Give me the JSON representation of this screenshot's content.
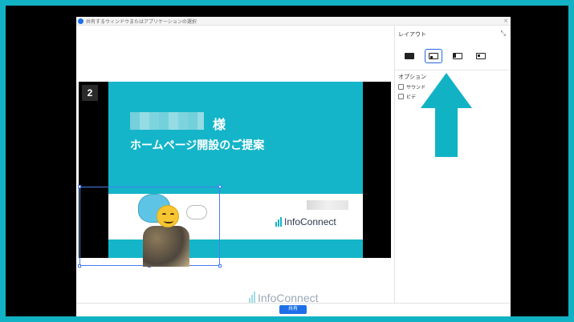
{
  "window": {
    "title": "共有するウィンドウまたはアプリケーションの選択",
    "close_glyph": "×"
  },
  "slide": {
    "page_number": "2",
    "honorific": "様",
    "title": "ホームページ開設のご提案",
    "logo_text": "InfoConnect"
  },
  "preview": {
    "logo_text": "InfoConnect"
  },
  "layout_panel": {
    "title": "レイアウト",
    "collapse_glyph": "⤡",
    "options_title": "オプション",
    "options": [
      {
        "label": "サウンド",
        "checked": false
      },
      {
        "label": "ビデ",
        "checked": false
      }
    ],
    "selected_layout_index": 1
  },
  "footer": {
    "share_label": "共有"
  },
  "colors": {
    "accent": "#12b2c5",
    "button_blue": "#1d6fe8",
    "selection_border": "#2166e8"
  },
  "icons": [
    "app-icon",
    "close-icon",
    "collapse-icon",
    "layout-full-icon",
    "layout-pip-icon",
    "layout-side-icon",
    "layout-pip-right-icon",
    "arrow-up-icon"
  ]
}
